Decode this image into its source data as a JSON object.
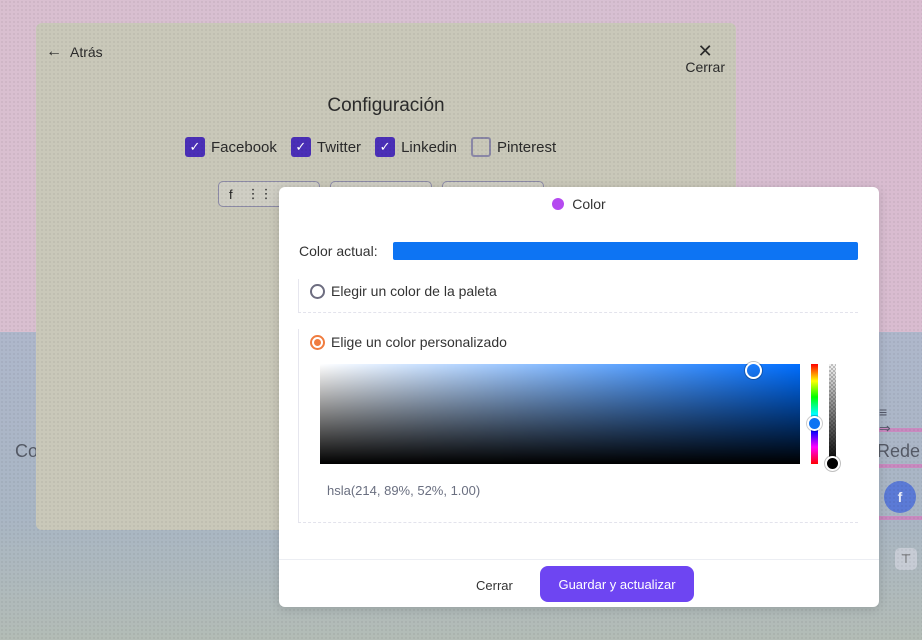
{
  "background": {
    "left_text": "Co",
    "right_text": "Rede",
    "fb_letter": "f",
    "right_icons": "≡ ⇒",
    "filter_icon": "⊤"
  },
  "settings": {
    "back_label": "Atrás",
    "close_label": "Cerrar",
    "title": "Configuración",
    "networks": [
      {
        "label": "Facebook",
        "checked": true
      },
      {
        "label": "Twitter",
        "checked": true
      },
      {
        "label": "Linkedin",
        "checked": true
      },
      {
        "label": "Pinterest",
        "checked": false
      }
    ],
    "mini_fb": "f"
  },
  "dialog": {
    "title": "Color",
    "accent_dot": "#b54af0",
    "current_label": "Color actual:",
    "current_color": "#0d74f3",
    "option_palette": "Elegir un color de la paleta",
    "option_custom": "Elige un color personalizado",
    "selected_option": "custom",
    "hsla_value": "hsla(214, 89%, 52%, 1.00)",
    "cancel_label": "Cerrar",
    "save_label": "Guardar y actualizar",
    "save_color": "#6e45f2"
  }
}
